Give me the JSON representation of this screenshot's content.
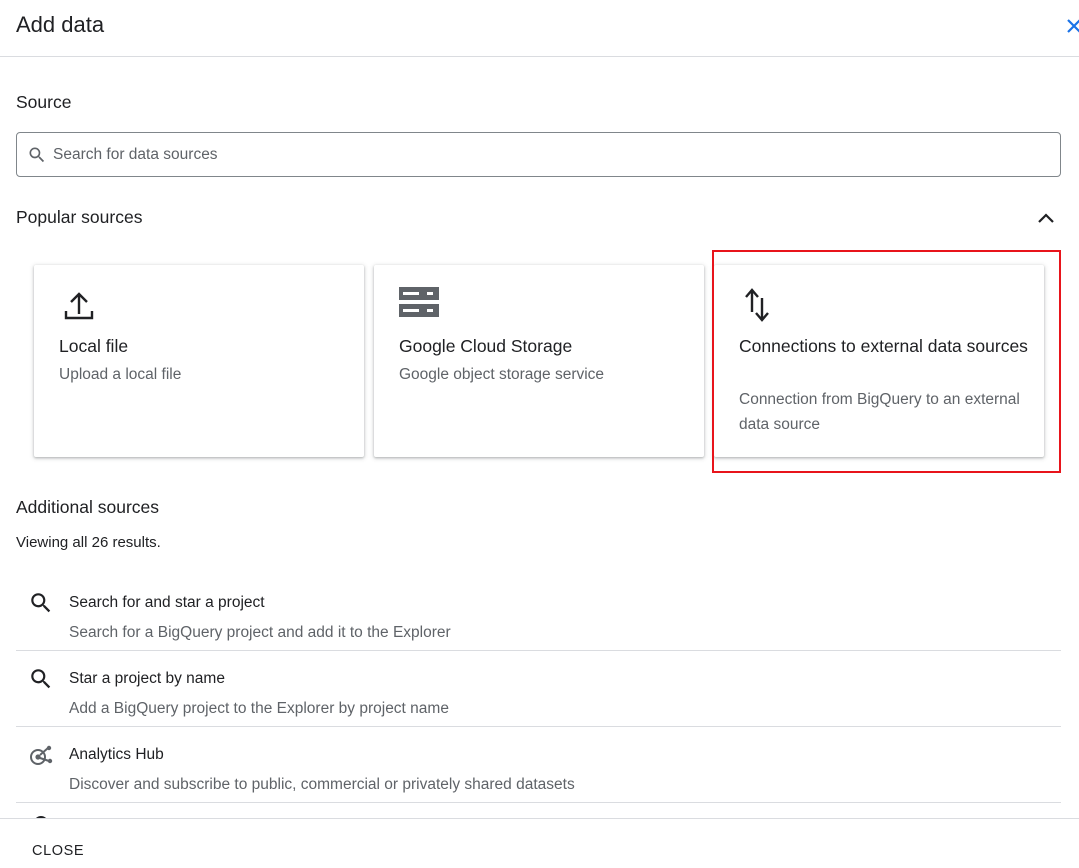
{
  "header": {
    "title": "Add data"
  },
  "source": {
    "label": "Source",
    "search_placeholder": "Search for data sources",
    "search_value": ""
  },
  "popular": {
    "label": "Popular sources",
    "cards": [
      {
        "title": "Local file",
        "description": "Upload a local file",
        "icon": "upload-icon"
      },
      {
        "title": "Google Cloud Storage",
        "description": "Google object storage service",
        "icon": "storage-icon"
      },
      {
        "title": "Connections to external data sources",
        "description": "Connection from BigQuery to an external data source",
        "icon": "swap-vertical-icon"
      }
    ]
  },
  "additional": {
    "label": "Additional sources",
    "result_count": "Viewing all 26 results.",
    "items": [
      {
        "title": "Search for and star a project",
        "description": "Search for a BigQuery project and add it to the Explorer",
        "icon": "search-icon"
      },
      {
        "title": "Star a project by name",
        "description": "Add a BigQuery project to the Explorer by project name",
        "icon": "search-icon"
      },
      {
        "title": "Analytics Hub",
        "description": "Discover and subscribe to public, commercial or privately shared datasets",
        "icon": "analytics-hub-icon"
      }
    ]
  },
  "footer": {
    "close_label": "CLOSE"
  },
  "colors": {
    "highlight": "#e8141b",
    "accent": "#1a73e8",
    "text_secondary": "#5f6368"
  }
}
